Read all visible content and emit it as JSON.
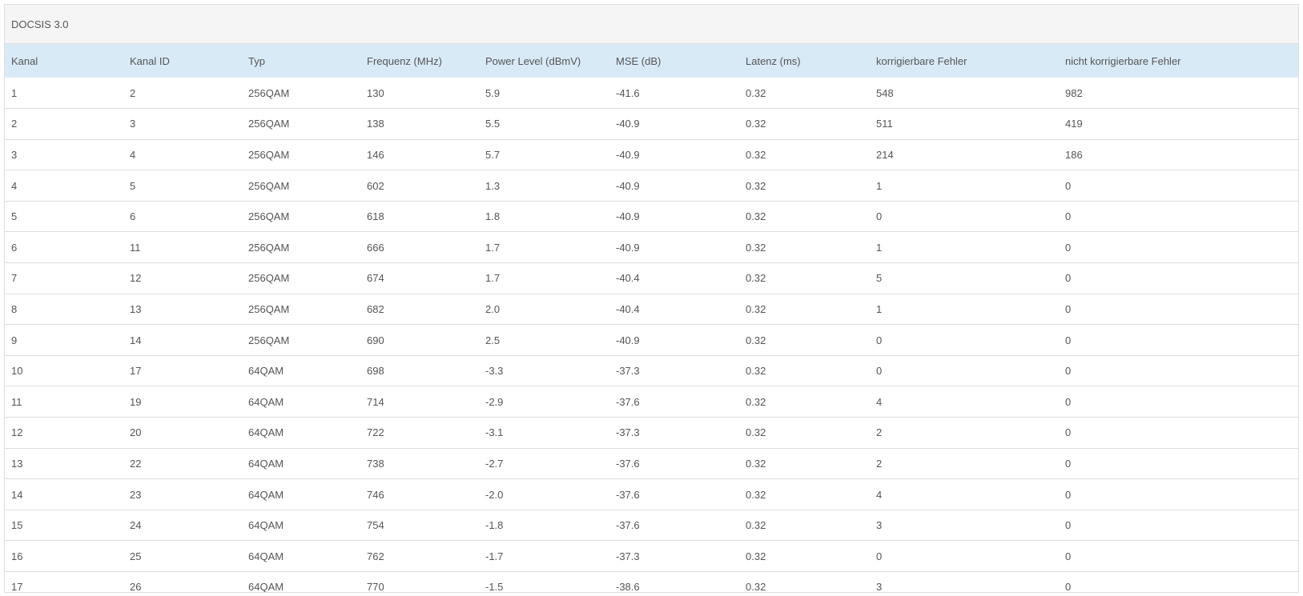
{
  "panel": {
    "title": "DOCSIS 3.0"
  },
  "table": {
    "headers": [
      "Kanal",
      "Kanal ID",
      "Typ",
      "Frequenz (MHz)",
      "Power Level (dBmV)",
      "MSE (dB)",
      "Latenz (ms)",
      "korrigierbare Fehler",
      "nicht korrigierbare Fehler"
    ],
    "rows": [
      [
        "1",
        "2",
        "256QAM",
        "130",
        "5.9",
        "-41.6",
        "0.32",
        "548",
        "982"
      ],
      [
        "2",
        "3",
        "256QAM",
        "138",
        "5.5",
        "-40.9",
        "0.32",
        "511",
        "419"
      ],
      [
        "3",
        "4",
        "256QAM",
        "146",
        "5.7",
        "-40.9",
        "0.32",
        "214",
        "186"
      ],
      [
        "4",
        "5",
        "256QAM",
        "602",
        "1.3",
        "-40.9",
        "0.32",
        "1",
        "0"
      ],
      [
        "5",
        "6",
        "256QAM",
        "618",
        "1.8",
        "-40.9",
        "0.32",
        "0",
        "0"
      ],
      [
        "6",
        "11",
        "256QAM",
        "666",
        "1.7",
        "-40.9",
        "0.32",
        "1",
        "0"
      ],
      [
        "7",
        "12",
        "256QAM",
        "674",
        "1.7",
        "-40.4",
        "0.32",
        "5",
        "0"
      ],
      [
        "8",
        "13",
        "256QAM",
        "682",
        "2.0",
        "-40.4",
        "0.32",
        "1",
        "0"
      ],
      [
        "9",
        "14",
        "256QAM",
        "690",
        "2.5",
        "-40.9",
        "0.32",
        "0",
        "0"
      ],
      [
        "10",
        "17",
        "64QAM",
        "698",
        "-3.3",
        "-37.3",
        "0.32",
        "0",
        "0"
      ],
      [
        "11",
        "19",
        "64QAM",
        "714",
        "-2.9",
        "-37.6",
        "0.32",
        "4",
        "0"
      ],
      [
        "12",
        "20",
        "64QAM",
        "722",
        "-3.1",
        "-37.3",
        "0.32",
        "2",
        "0"
      ],
      [
        "13",
        "22",
        "64QAM",
        "738",
        "-2.7",
        "-37.6",
        "0.32",
        "2",
        "0"
      ],
      [
        "14",
        "23",
        "64QAM",
        "746",
        "-2.0",
        "-37.6",
        "0.32",
        "4",
        "0"
      ],
      [
        "15",
        "24",
        "64QAM",
        "754",
        "-1.8",
        "-37.6",
        "0.32",
        "3",
        "0"
      ],
      [
        "16",
        "25",
        "64QAM",
        "762",
        "-1.7",
        "-37.3",
        "0.32",
        "0",
        "0"
      ],
      [
        "17",
        "26",
        "64QAM",
        "770",
        "-1.5",
        "-38.6",
        "0.32",
        "3",
        "0"
      ]
    ]
  }
}
